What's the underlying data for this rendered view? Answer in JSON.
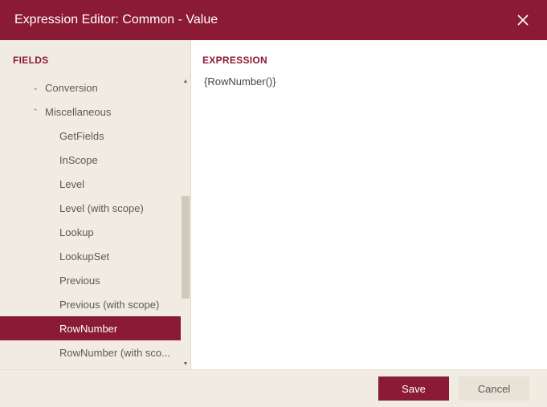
{
  "titlebar": {
    "title": "Expression Editor: Common - Value"
  },
  "left": {
    "heading": "FIELDS",
    "tree": [
      {
        "label": "Conversion",
        "level": 1,
        "arrow": "down",
        "selected": false
      },
      {
        "label": "Miscellaneous",
        "level": 1,
        "arrow": "up",
        "selected": false
      },
      {
        "label": "GetFields",
        "level": 2,
        "arrow": "none",
        "selected": false
      },
      {
        "label": "InScope",
        "level": 2,
        "arrow": "none",
        "selected": false
      },
      {
        "label": "Level",
        "level": 2,
        "arrow": "none",
        "selected": false
      },
      {
        "label": "Level (with scope)",
        "level": 2,
        "arrow": "none",
        "selected": false
      },
      {
        "label": "Lookup",
        "level": 2,
        "arrow": "none",
        "selected": false
      },
      {
        "label": "LookupSet",
        "level": 2,
        "arrow": "none",
        "selected": false
      },
      {
        "label": "Previous",
        "level": 2,
        "arrow": "none",
        "selected": false
      },
      {
        "label": "Previous (with scope)",
        "level": 2,
        "arrow": "none",
        "selected": false
      },
      {
        "label": "RowNumber",
        "level": 2,
        "arrow": "none",
        "selected": true
      },
      {
        "label": "RowNumber (with sco...",
        "level": 2,
        "arrow": "none",
        "selected": false
      }
    ]
  },
  "right": {
    "heading": "EXPRESSION",
    "value": "{RowNumber()}"
  },
  "footer": {
    "save": "Save",
    "cancel": "Cancel"
  },
  "colors": {
    "accent": "#8b1a35",
    "panel_bg": "#f1ece2"
  }
}
